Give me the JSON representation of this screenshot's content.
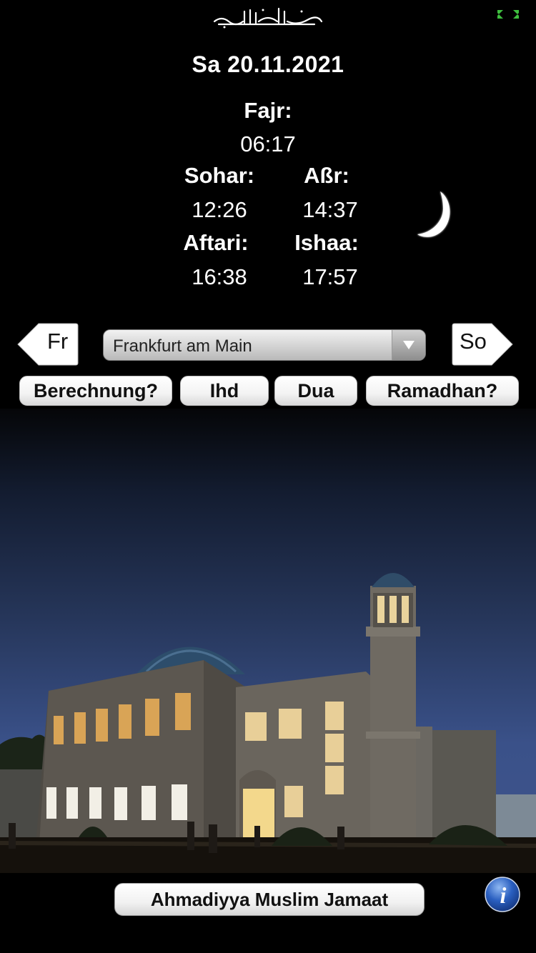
{
  "header": {
    "date": "Sa 20.11.2021"
  },
  "prayers": {
    "fajr": {
      "label": "Fajr:",
      "time": "06:17"
    },
    "sohar": {
      "label": "Sohar:",
      "time": "12:26"
    },
    "asr": {
      "label": "Aßr:",
      "time": "14:37"
    },
    "aftari": {
      "label": "Aftari:",
      "time": "16:38"
    },
    "ishaa": {
      "label": "Ishaa:",
      "time": "17:57"
    }
  },
  "navigation": {
    "prev_day": "Fr",
    "next_day": "So",
    "city": "Frankfurt am Main"
  },
  "buttons": {
    "berechnung": "Berechnung?",
    "ihd": "Ihd",
    "dua": "Dua",
    "ramadhan": "Ramadhan?"
  },
  "footer": {
    "jamaat_button": "Ahmadiyya Muslim Jamaat"
  },
  "icons": {
    "header": [
      "calligraphy-logo",
      "fullscreen-icon",
      "crescent-moon-icon"
    ],
    "nav": [
      "chevron-down-icon"
    ],
    "footer": [
      "info-icon"
    ]
  },
  "colors": {
    "background": "#000000",
    "text": "#ffffff",
    "fullscreen_icon": "#3fbf3f",
    "info_icon": "#2a5fc0",
    "sky": "#3a5189"
  }
}
